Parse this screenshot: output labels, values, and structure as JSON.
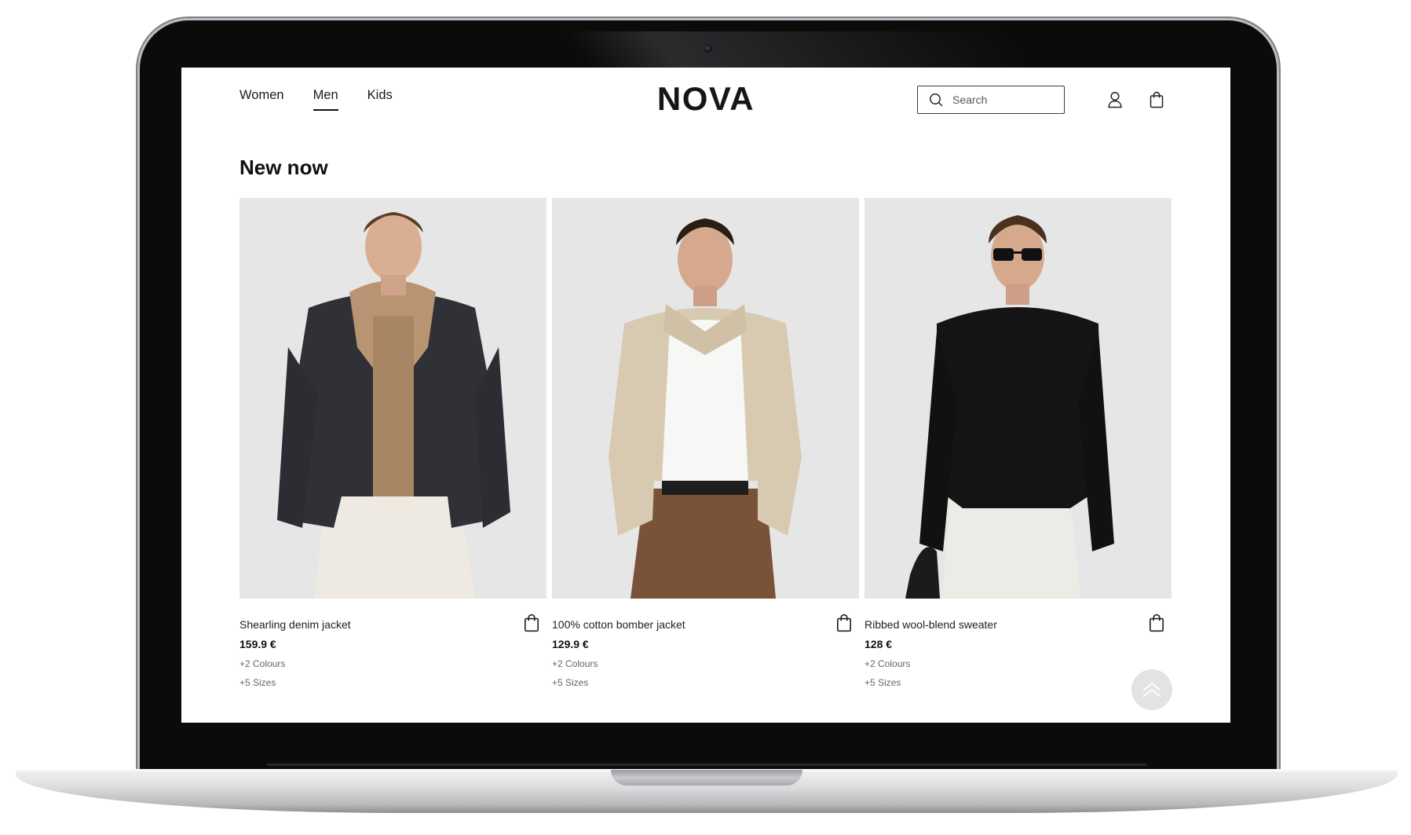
{
  "nav": {
    "items": [
      {
        "label": "Women",
        "active": false
      },
      {
        "label": "Men",
        "active": true
      },
      {
        "label": "Kids",
        "active": false
      }
    ]
  },
  "brand": {
    "logo": "NOVA"
  },
  "search": {
    "placeholder": "Search",
    "icon": "search-icon"
  },
  "header_icons": {
    "account": "user-icon",
    "cart": "shopping-bag-icon"
  },
  "section": {
    "title": "New now"
  },
  "products": [
    {
      "name": "Shearling denim jacket",
      "price": "159.9 €",
      "colours": "+2 Colours",
      "sizes": "+5 Sizes",
      "cart_icon": "shopping-bag-icon"
    },
    {
      "name": "100% cotton bomber jacket",
      "price": "129.9 €",
      "colours": "+2 Colours",
      "sizes": "+5 Sizes",
      "cart_icon": "shopping-bag-icon"
    },
    {
      "name": "Ribbed wool-blend sweater",
      "price": "128 €",
      "colours": "+2 Colours",
      "sizes": "+5 Sizes",
      "cart_icon": "shopping-bag-icon"
    }
  ],
  "back_to_top": {
    "icon": "double-chevron-up-icon"
  },
  "colors": {
    "background": "#ffffff",
    "text": "#111111",
    "photo_bg": "#e6e6e7",
    "laptop_bezel": "#0b0b0c"
  }
}
